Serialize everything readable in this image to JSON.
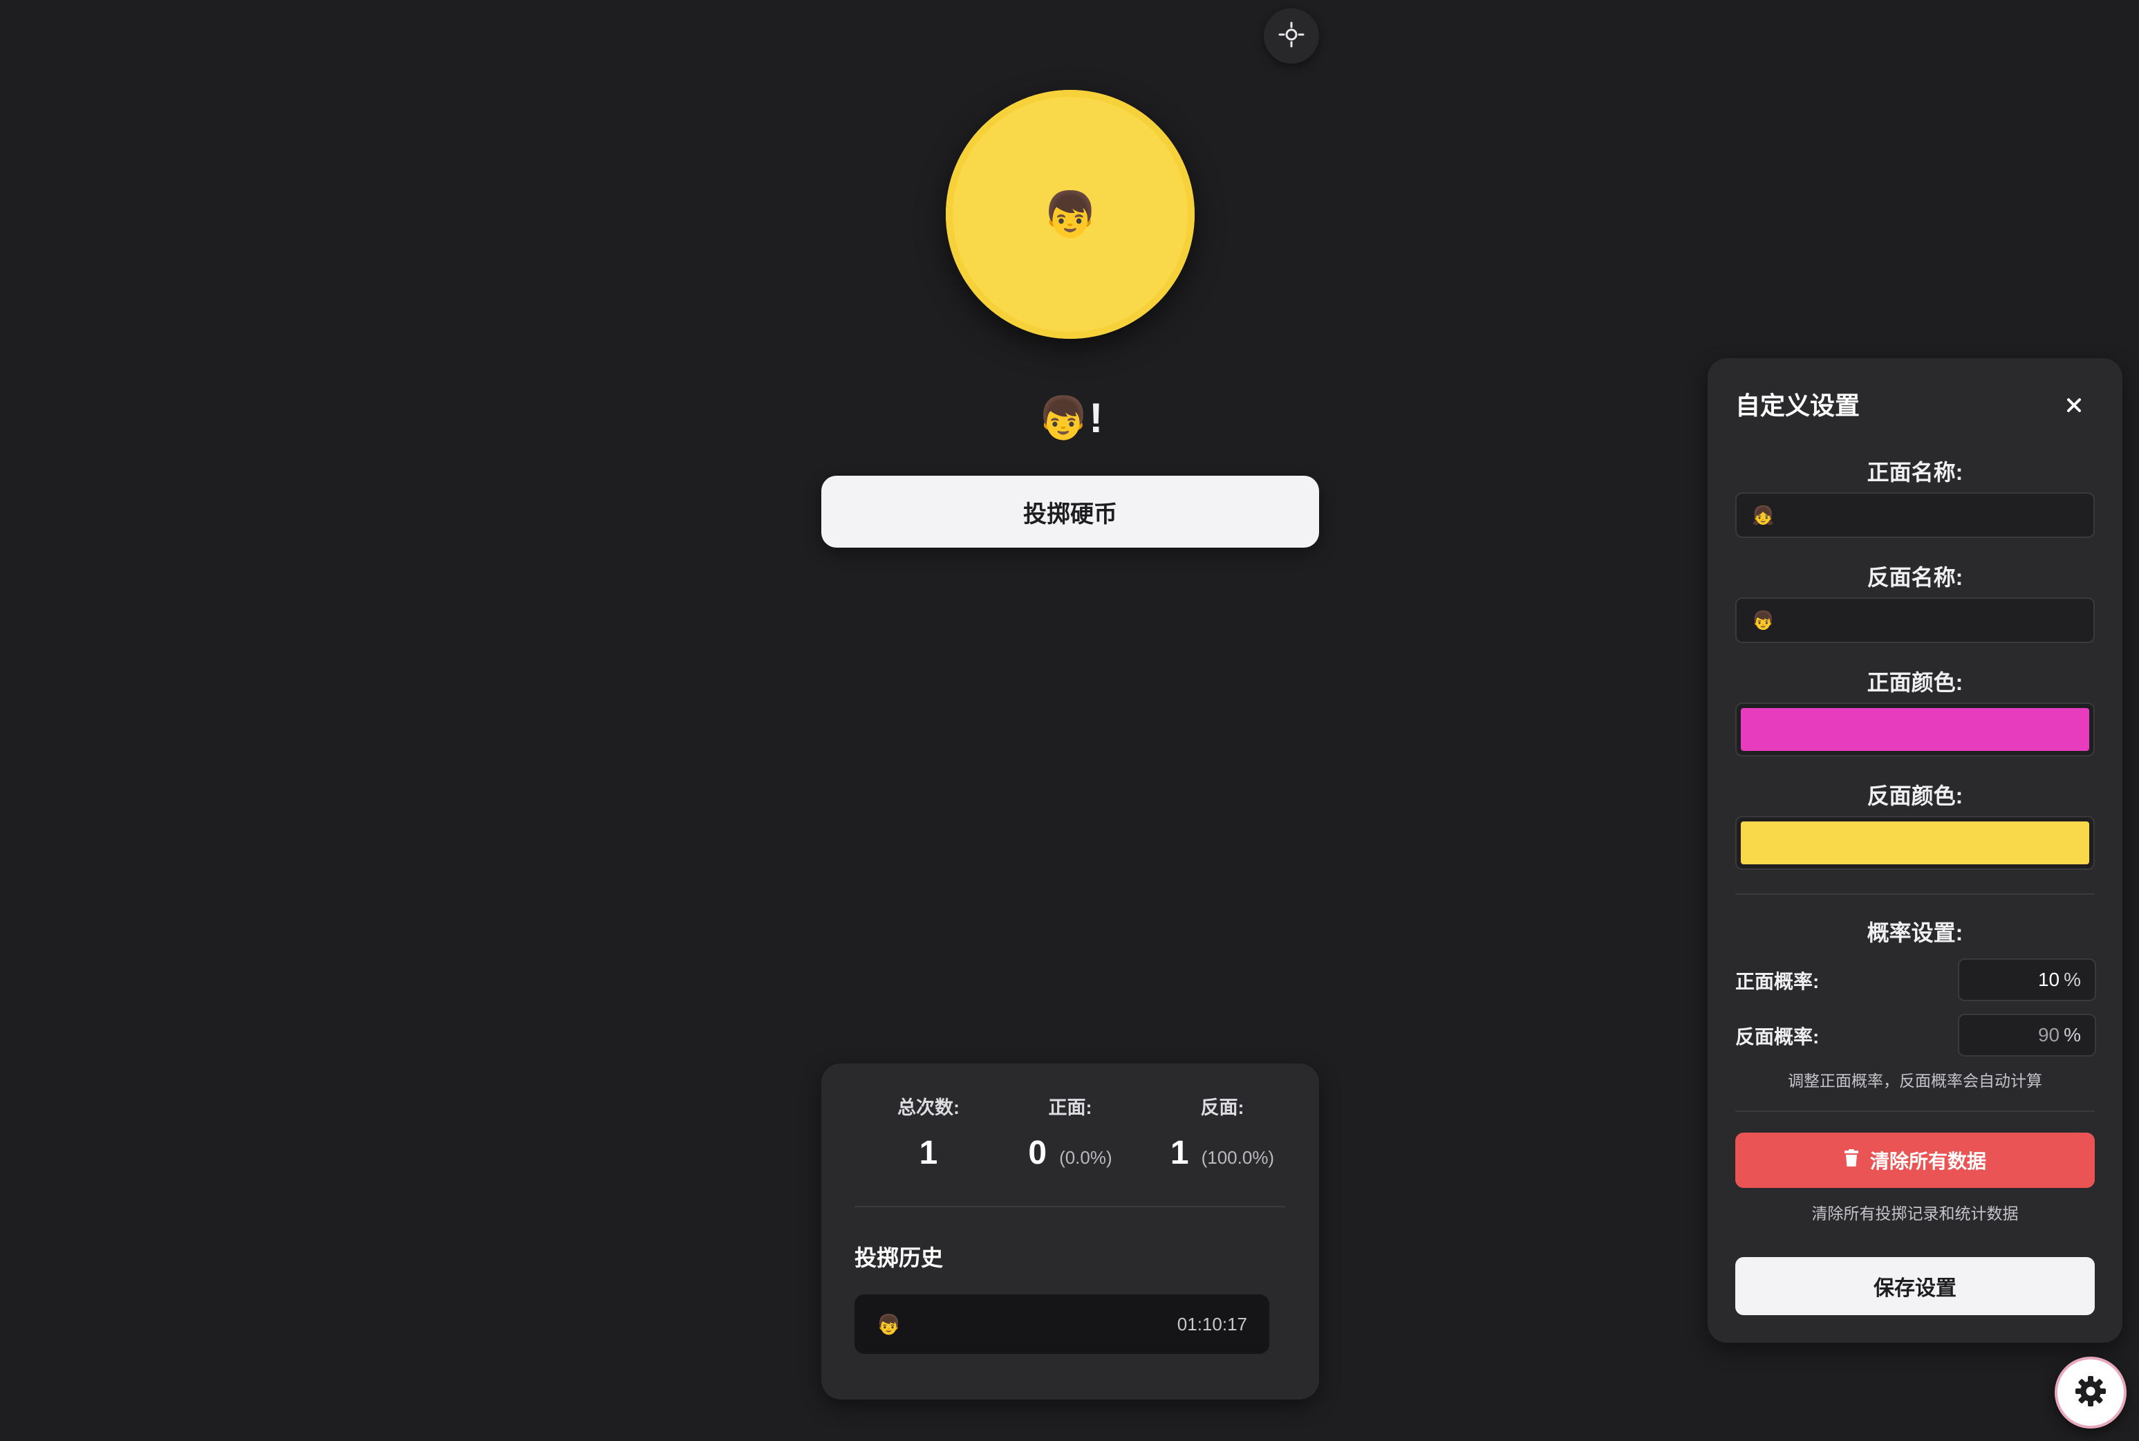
{
  "coin": {
    "face": "👦",
    "icon": "boy-face"
  },
  "result": {
    "text": "👦!"
  },
  "flip_button": {
    "label": "投掷硬币"
  },
  "stats": {
    "total": {
      "label": "总次数:",
      "value": "1"
    },
    "heads": {
      "label": "正面:",
      "value": "0",
      "percent": "(0.0%)"
    },
    "tails": {
      "label": "反面:",
      "value": "1",
      "percent": "(100.0%)"
    }
  },
  "history": {
    "title": "投掷历史",
    "items": [
      {
        "face": "👦",
        "time": "01:10:17"
      }
    ]
  },
  "settings": {
    "title": "自定义设置",
    "heads_name": {
      "label": "正面名称:",
      "value": "👧"
    },
    "tails_name": {
      "label": "反面名称:",
      "value": "👦"
    },
    "heads_color": {
      "label": "正面颜色:",
      "value": "#e83cbf"
    },
    "tails_color": {
      "label": "反面颜色:",
      "value": "#f9d84a"
    },
    "probability": {
      "title": "概率设置:",
      "heads_label": "正面概率:",
      "heads_value": "10",
      "tails_label": "反面概率:",
      "tails_value": "90",
      "unit": "%",
      "hint": "调整正面概率，反面概率会自动计算"
    },
    "clear_button": {
      "label": "清除所有数据",
      "icon": "trash-icon"
    },
    "clear_hint": "清除所有投掷记录和统计数据",
    "save_button": {
      "label": "保存设置"
    }
  },
  "colors": {
    "background": "#1e1e20",
    "card": "#2a2a2d",
    "accent_danger": "#ea5455",
    "coin": "#f9d84a"
  }
}
